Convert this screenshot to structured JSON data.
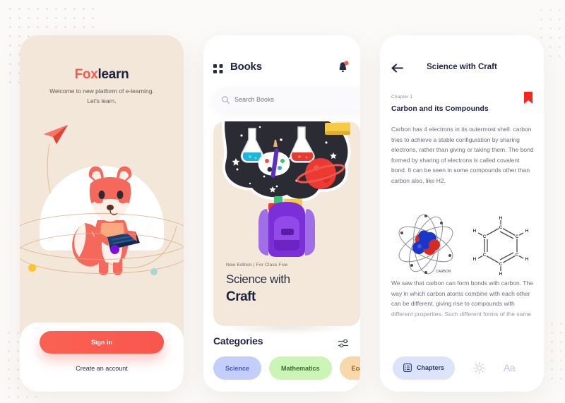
{
  "onboarding": {
    "brand_fox": "Fox",
    "brand_learn": "learn",
    "welcome": "Welcome to new platform of e-learning. Let's learn.",
    "signin_label": "Sign in",
    "create_account_label": "Create an account",
    "accent_color": "#f9574b",
    "panel_bg": "#f2e7d9",
    "dot_colors": {
      "purple": "#7a0fe0",
      "yellow": "#fec42e",
      "teal": "#a8d6d4"
    },
    "icons": {
      "plane": "paper-plane-icon",
      "fox": "fox-reading-illustration"
    }
  },
  "books": {
    "title": "Books",
    "grid_icon": "grid-icon",
    "bell_icon": "notification-bell-icon",
    "has_notification": true,
    "search": {
      "placeholder": "Search Books",
      "value": "",
      "icon": "search-icon"
    },
    "featured": {
      "meta": "New Edition | For Class Five",
      "title_line1": "Science with",
      "title_line2": "Craft",
      "card_bg": "#f3e8da",
      "art": "backpack-science-illustration"
    },
    "categories_title": "Categories",
    "filter_icon": "filter-sliders-icon",
    "chips": [
      {
        "label": "Science",
        "bg": "#c3cefa",
        "fg": "#4a57c4"
      },
      {
        "label": "Mathematics",
        "bg": "#caf5b4",
        "fg": "#3e6b33"
      },
      {
        "label": "Economics",
        "bg": "#f8d7ab",
        "fg": "#8a6028"
      }
    ]
  },
  "reader": {
    "back_icon": "back-arrow-icon",
    "title": "Science with Craft",
    "chapter_label": "Chapter 1",
    "chapter_title": "Carbon and its Compounds",
    "bookmark_icon": "bookmark-icon",
    "bookmark_color": "#f9251f",
    "paragraph1": "Carbon has 4 electrons in its outermost shell. carbon tries to achieve a stable configuration by sharing electrons, rather than giving or taking them. The bond formed by sharing of electrons is called covalent bond. It can be seen in some compounds other than carbon also, like H2.",
    "paragraph2": "We saw that carbon can form bonds with carbon. The way in which carbon atoms combine with each other can be different, giving rise to compounds with different properties. Such different forms of the same",
    "figures": [
      {
        "name": "carbon-atom-diagram",
        "caption": "CARBON"
      },
      {
        "name": "benzene-ring-diagram",
        "atoms": [
          "C",
          "C",
          "C",
          "C",
          "C",
          "C"
        ],
        "hydrogens": [
          "H",
          "H",
          "H",
          "H",
          "H",
          "H"
        ]
      }
    ],
    "toolbar": {
      "chapters_label": "Chapters",
      "chapters_icon": "list-icon",
      "brightness_icon": "sun-brightness-icon",
      "textsize_label": "Aa"
    }
  }
}
